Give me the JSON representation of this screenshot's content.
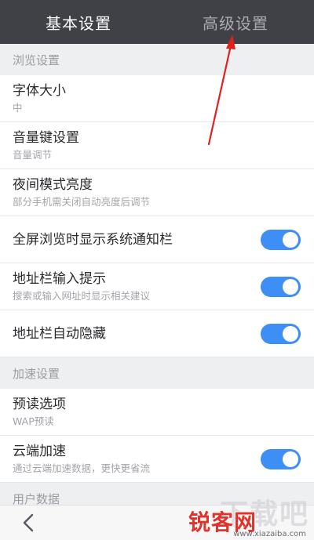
{
  "tabs": [
    {
      "label": "基本设置",
      "active": true
    },
    {
      "label": "高级设置",
      "active": false
    }
  ],
  "sections": [
    {
      "header": "浏览设置",
      "items": [
        {
          "title": "字体大小",
          "subtitle": "中",
          "toggle": null
        },
        {
          "title": "音量键设置",
          "subtitle": "音量调节",
          "toggle": null
        },
        {
          "title": "夜间模式亮度",
          "subtitle": "部分手机需关闭自动亮度后调节",
          "toggle": null
        },
        {
          "title": "全屏浏览时显示系统通知栏",
          "subtitle": "",
          "toggle": true
        },
        {
          "title": "地址栏输入提示",
          "subtitle": "搜索或输入网址时显示相关建议",
          "toggle": true
        },
        {
          "title": "地址栏自动隐藏",
          "subtitle": "",
          "toggle": true
        }
      ]
    },
    {
      "header": "加速设置",
      "items": [
        {
          "title": "预读选项",
          "subtitle": "WAP预读",
          "toggle": null
        },
        {
          "title": "云端加速",
          "subtitle": "通过云端加速数据，更快更省流",
          "toggle": true
        }
      ]
    },
    {
      "header": "用户数据",
      "items": []
    }
  ],
  "bottom": {
    "back_icon": "chevron-left-icon"
  },
  "watermark": {
    "site": "锐客网",
    "url": "www.xiazaiba.com",
    "big": "下载吧"
  },
  "colors": {
    "topbar": "#3f4147",
    "toggle_on": "#3d8ff5",
    "arrow": "#e0211f"
  }
}
